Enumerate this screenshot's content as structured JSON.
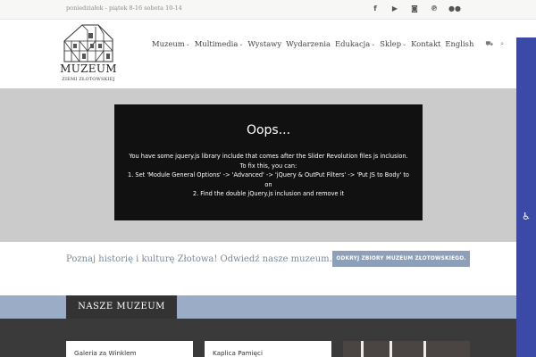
{
  "topbar": {
    "hours": "poniedziałek - piątek 8-16 sobota 10-14",
    "social_icons": [
      "facebook-icon",
      "youtube-icon",
      "instagram-icon",
      "pinterest-icon",
      "flickr-icon"
    ]
  },
  "logo": {
    "name": "MUZEUM",
    "subtitle": "ZIEMI ZŁOTOWSKIEJ"
  },
  "nav": {
    "items": [
      {
        "label": "Muzeum",
        "dropdown": true
      },
      {
        "label": "Multimedia",
        "dropdown": true
      },
      {
        "label": "Wystawy",
        "dropdown": false
      },
      {
        "label": "Wydarzenia",
        "dropdown": false
      },
      {
        "label": "Edukacja",
        "dropdown": true
      },
      {
        "label": "Sklep",
        "dropdown": true
      },
      {
        "label": "Kontakt",
        "dropdown": false
      },
      {
        "label": "English",
        "dropdown": false
      }
    ],
    "cart_icon": "cart-icon",
    "search_icon": "search-icon"
  },
  "slider_error": {
    "title": "Oops...",
    "line1": "You have some jquery.js library include that comes after the Slider Revolution files js inclusion.",
    "line2": "To fix this, you can:",
    "line3": "1. Set 'Module General Options' -> 'Advanced' -> 'jQuery & OutPut Filters' -> 'Put JS to Body' to on",
    "line4": "2. Find the double jQuery.js inclusion and remove it"
  },
  "intro": {
    "text": "Poznaj historię i kulturę Złotowa! Odwiedź nasze muzeum.",
    "button": "ODKRYJ ZBIORY MUZEUM ZŁOTOWSKIEGO."
  },
  "section": {
    "title": "NASZE MUZEUM",
    "cards": [
      "Galeria za Winklem",
      "Kaplica Pamięci"
    ]
  },
  "colors": {
    "accent_blue": "#3a4aa6",
    "section_blue": "#9aacc6",
    "button_blue": "#8d9fb9"
  }
}
